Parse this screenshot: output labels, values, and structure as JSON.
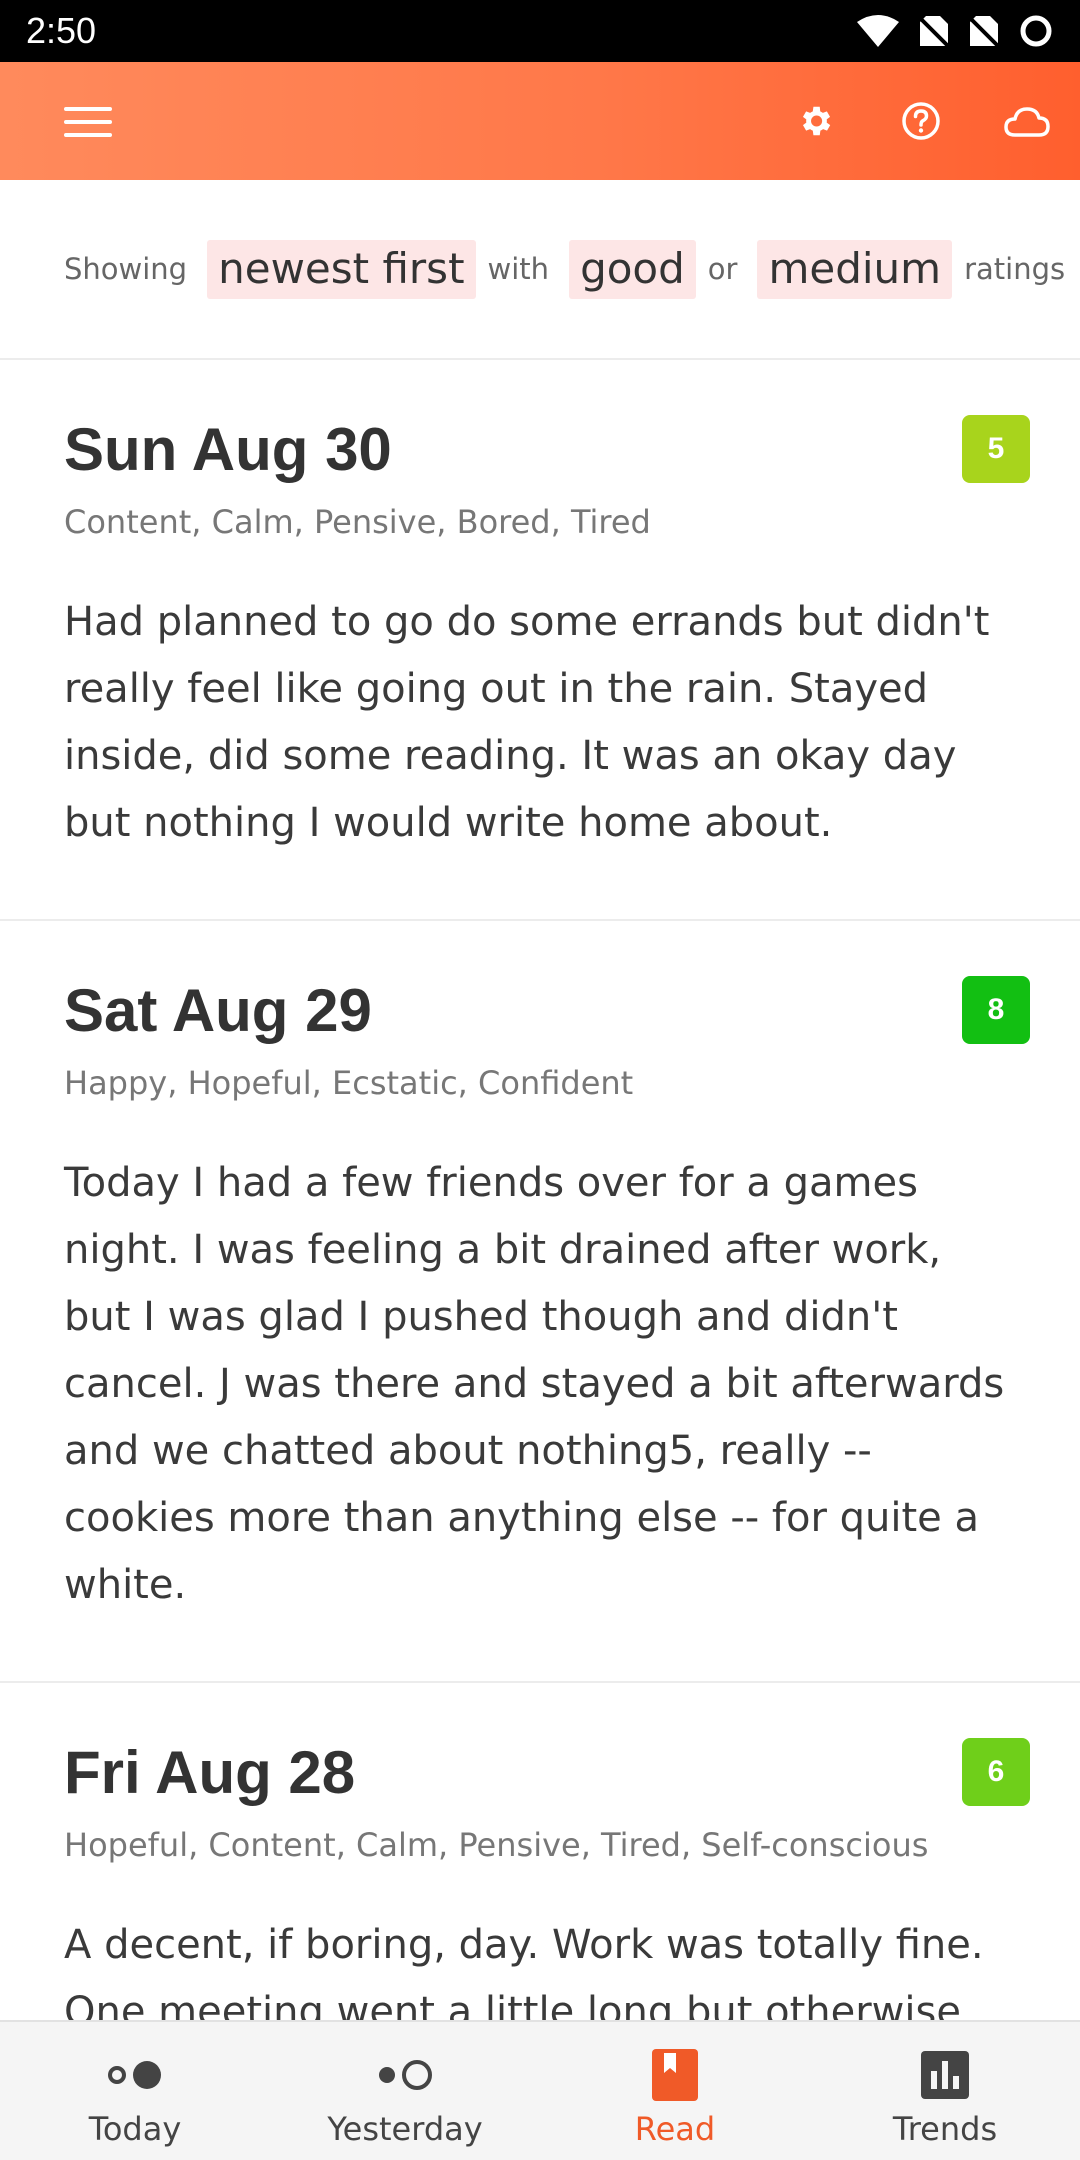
{
  "status_bar": {
    "time": "2:50",
    "icons": [
      "wifi-icon",
      "no-sim-icon",
      "no-sim-icon",
      "loading-ring-icon"
    ]
  },
  "app_bar": {
    "menu_icon": "hamburger-menu-icon",
    "actions": [
      "gear-icon",
      "help-circle-icon",
      "cloud-icon"
    ],
    "gradient": [
      "#ff8a5c",
      "#ff5f2e"
    ]
  },
  "filter": {
    "showing": "Showing",
    "order": "newest first",
    "with": "with",
    "rating_a": "good",
    "or": "or",
    "rating_b": "medium",
    "ratings": "ratings"
  },
  "entries": [
    {
      "date": "Sun Aug 30",
      "moods": "Content, Calm, Pensive, Bored, Tired",
      "text": "Had planned to go do some errands but didn't really feel like going out in the rain. Stayed inside, did some reading. It was an okay day but nothing I would write home about.",
      "rating": "5",
      "rating_color": "#a8d41c"
    },
    {
      "date": "Sat Aug 29",
      "moods": "Happy, Hopeful, Ecstatic, Confident",
      "text": "Today I had a few friends over for a games night. I was feeling a bit drained after work, but I was glad I pushed though and didn't cancel. J was there and stayed a bit afterwards and we chatted about nothing5, really -- cookies more than anything else -- for quite a white.",
      "rating": "8",
      "rating_color": "#12bf12"
    },
    {
      "date": "Fri Aug 28",
      "moods": "Hopeful, Content, Calm, Pensive, Tired, Self-conscious",
      "text": "A decent, if boring, day. Work was totally fine. One meeting went a little long but otherwise",
      "rating": "6",
      "rating_color": "#6fcf1a"
    }
  ],
  "bottom_nav": {
    "items": [
      {
        "label": "Today",
        "icon": "today-dots-icon"
      },
      {
        "label": "Yesterday",
        "icon": "yesterday-dots-icon"
      },
      {
        "label": "Read",
        "icon": "book-icon"
      },
      {
        "label": "Trends",
        "icon": "bar-chart-icon"
      }
    ],
    "active": "Read",
    "active_color": "#f05a28"
  }
}
